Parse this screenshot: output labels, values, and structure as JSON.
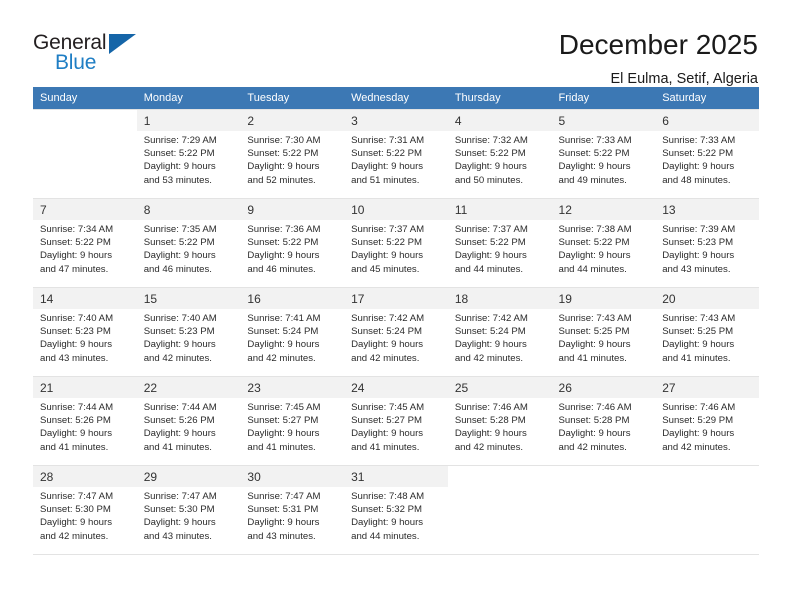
{
  "brand": {
    "name_part1": "General",
    "name_part2": "Blue",
    "triangle_color": "#1565a8",
    "blue_color": "#1f7ec4"
  },
  "header": {
    "title": "December 2025",
    "subtitle": "El Eulma, Setif, Algeria",
    "header_bg": "#3c78b4",
    "header_text": "#ffffff"
  },
  "weekdays": [
    "Sunday",
    "Monday",
    "Tuesday",
    "Wednesday",
    "Thursday",
    "Friday",
    "Saturday"
  ],
  "labels": {
    "sunrise_prefix": "Sunrise: ",
    "sunset_prefix": "Sunset: ",
    "daylight_prefix": "Daylight: "
  },
  "weeks": [
    [
      {
        "day": "",
        "empty": true
      },
      {
        "day": "1",
        "sunrise": "Sunrise: 7:29 AM",
        "sunset": "Sunset: 5:22 PM",
        "daylight1": "Daylight: 9 hours",
        "daylight2": "and 53 minutes."
      },
      {
        "day": "2",
        "sunrise": "Sunrise: 7:30 AM",
        "sunset": "Sunset: 5:22 PM",
        "daylight1": "Daylight: 9 hours",
        "daylight2": "and 52 minutes."
      },
      {
        "day": "3",
        "sunrise": "Sunrise: 7:31 AM",
        "sunset": "Sunset: 5:22 PM",
        "daylight1": "Daylight: 9 hours",
        "daylight2": "and 51 minutes."
      },
      {
        "day": "4",
        "sunrise": "Sunrise: 7:32 AM",
        "sunset": "Sunset: 5:22 PM",
        "daylight1": "Daylight: 9 hours",
        "daylight2": "and 50 minutes."
      },
      {
        "day": "5",
        "sunrise": "Sunrise: 7:33 AM",
        "sunset": "Sunset: 5:22 PM",
        "daylight1": "Daylight: 9 hours",
        "daylight2": "and 49 minutes."
      },
      {
        "day": "6",
        "sunrise": "Sunrise: 7:33 AM",
        "sunset": "Sunset: 5:22 PM",
        "daylight1": "Daylight: 9 hours",
        "daylight2": "and 48 minutes."
      }
    ],
    [
      {
        "day": "7",
        "sunrise": "Sunrise: 7:34 AM",
        "sunset": "Sunset: 5:22 PM",
        "daylight1": "Daylight: 9 hours",
        "daylight2": "and 47 minutes."
      },
      {
        "day": "8",
        "sunrise": "Sunrise: 7:35 AM",
        "sunset": "Sunset: 5:22 PM",
        "daylight1": "Daylight: 9 hours",
        "daylight2": "and 46 minutes."
      },
      {
        "day": "9",
        "sunrise": "Sunrise: 7:36 AM",
        "sunset": "Sunset: 5:22 PM",
        "daylight1": "Daylight: 9 hours",
        "daylight2": "and 46 minutes."
      },
      {
        "day": "10",
        "sunrise": "Sunrise: 7:37 AM",
        "sunset": "Sunset: 5:22 PM",
        "daylight1": "Daylight: 9 hours",
        "daylight2": "and 45 minutes."
      },
      {
        "day": "11",
        "sunrise": "Sunrise: 7:37 AM",
        "sunset": "Sunset: 5:22 PM",
        "daylight1": "Daylight: 9 hours",
        "daylight2": "and 44 minutes."
      },
      {
        "day": "12",
        "sunrise": "Sunrise: 7:38 AM",
        "sunset": "Sunset: 5:22 PM",
        "daylight1": "Daylight: 9 hours",
        "daylight2": "and 44 minutes."
      },
      {
        "day": "13",
        "sunrise": "Sunrise: 7:39 AM",
        "sunset": "Sunset: 5:23 PM",
        "daylight1": "Daylight: 9 hours",
        "daylight2": "and 43 minutes."
      }
    ],
    [
      {
        "day": "14",
        "sunrise": "Sunrise: 7:40 AM",
        "sunset": "Sunset: 5:23 PM",
        "daylight1": "Daylight: 9 hours",
        "daylight2": "and 43 minutes."
      },
      {
        "day": "15",
        "sunrise": "Sunrise: 7:40 AM",
        "sunset": "Sunset: 5:23 PM",
        "daylight1": "Daylight: 9 hours",
        "daylight2": "and 42 minutes."
      },
      {
        "day": "16",
        "sunrise": "Sunrise: 7:41 AM",
        "sunset": "Sunset: 5:24 PM",
        "daylight1": "Daylight: 9 hours",
        "daylight2": "and 42 minutes."
      },
      {
        "day": "17",
        "sunrise": "Sunrise: 7:42 AM",
        "sunset": "Sunset: 5:24 PM",
        "daylight1": "Daylight: 9 hours",
        "daylight2": "and 42 minutes."
      },
      {
        "day": "18",
        "sunrise": "Sunrise: 7:42 AM",
        "sunset": "Sunset: 5:24 PM",
        "daylight1": "Daylight: 9 hours",
        "daylight2": "and 42 minutes."
      },
      {
        "day": "19",
        "sunrise": "Sunrise: 7:43 AM",
        "sunset": "Sunset: 5:25 PM",
        "daylight1": "Daylight: 9 hours",
        "daylight2": "and 41 minutes."
      },
      {
        "day": "20",
        "sunrise": "Sunrise: 7:43 AM",
        "sunset": "Sunset: 5:25 PM",
        "daylight1": "Daylight: 9 hours",
        "daylight2": "and 41 minutes."
      }
    ],
    [
      {
        "day": "21",
        "sunrise": "Sunrise: 7:44 AM",
        "sunset": "Sunset: 5:26 PM",
        "daylight1": "Daylight: 9 hours",
        "daylight2": "and 41 minutes."
      },
      {
        "day": "22",
        "sunrise": "Sunrise: 7:44 AM",
        "sunset": "Sunset: 5:26 PM",
        "daylight1": "Daylight: 9 hours",
        "daylight2": "and 41 minutes."
      },
      {
        "day": "23",
        "sunrise": "Sunrise: 7:45 AM",
        "sunset": "Sunset: 5:27 PM",
        "daylight1": "Daylight: 9 hours",
        "daylight2": "and 41 minutes."
      },
      {
        "day": "24",
        "sunrise": "Sunrise: 7:45 AM",
        "sunset": "Sunset: 5:27 PM",
        "daylight1": "Daylight: 9 hours",
        "daylight2": "and 41 minutes."
      },
      {
        "day": "25",
        "sunrise": "Sunrise: 7:46 AM",
        "sunset": "Sunset: 5:28 PM",
        "daylight1": "Daylight: 9 hours",
        "daylight2": "and 42 minutes."
      },
      {
        "day": "26",
        "sunrise": "Sunrise: 7:46 AM",
        "sunset": "Sunset: 5:28 PM",
        "daylight1": "Daylight: 9 hours",
        "daylight2": "and 42 minutes."
      },
      {
        "day": "27",
        "sunrise": "Sunrise: 7:46 AM",
        "sunset": "Sunset: 5:29 PM",
        "daylight1": "Daylight: 9 hours",
        "daylight2": "and 42 minutes."
      }
    ],
    [
      {
        "day": "28",
        "sunrise": "Sunrise: 7:47 AM",
        "sunset": "Sunset: 5:30 PM",
        "daylight1": "Daylight: 9 hours",
        "daylight2": "and 42 minutes."
      },
      {
        "day": "29",
        "sunrise": "Sunrise: 7:47 AM",
        "sunset": "Sunset: 5:30 PM",
        "daylight1": "Daylight: 9 hours",
        "daylight2": "and 43 minutes."
      },
      {
        "day": "30",
        "sunrise": "Sunrise: 7:47 AM",
        "sunset": "Sunset: 5:31 PM",
        "daylight1": "Daylight: 9 hours",
        "daylight2": "and 43 minutes."
      },
      {
        "day": "31",
        "sunrise": "Sunrise: 7:48 AM",
        "sunset": "Sunset: 5:32 PM",
        "daylight1": "Daylight: 9 hours",
        "daylight2": "and 44 minutes."
      },
      {
        "day": "",
        "empty": true
      },
      {
        "day": "",
        "empty": true
      },
      {
        "day": "",
        "empty": true
      }
    ]
  ]
}
